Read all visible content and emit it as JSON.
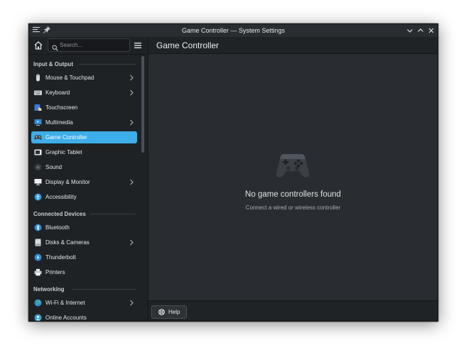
{
  "window": {
    "title": "Game Controller — System Settings"
  },
  "sidebar": {
    "search_placeholder": "Search...",
    "sections": [
      {
        "title": "Input & Output",
        "items": [
          {
            "label": "Mouse & Touchpad",
            "icon": "mouse-icon",
            "has_submenu": true
          },
          {
            "label": "Keyboard",
            "icon": "keyboard-icon",
            "has_submenu": true
          },
          {
            "label": "Touchscreen",
            "icon": "touchscreen-icon",
            "has_submenu": false
          },
          {
            "label": "Multimedia",
            "icon": "multimedia-icon",
            "has_submenu": true
          },
          {
            "label": "Game Controller",
            "icon": "gamepad-icon",
            "has_submenu": false,
            "active": true
          },
          {
            "label": "Graphic Tablet",
            "icon": "tablet-icon",
            "has_submenu": false
          },
          {
            "label": "Sound",
            "icon": "speaker-icon",
            "has_submenu": false
          },
          {
            "label": "Display & Monitor",
            "icon": "monitor-icon",
            "has_submenu": true
          },
          {
            "label": "Accessibility",
            "icon": "accessibility-icon",
            "has_submenu": false
          }
        ]
      },
      {
        "title": "Connected Devices",
        "items": [
          {
            "label": "Bluetooth",
            "icon": "bluetooth-icon",
            "has_submenu": false
          },
          {
            "label": "Disks & Cameras",
            "icon": "disk-icon",
            "has_submenu": true
          },
          {
            "label": "Thunderbolt",
            "icon": "thunderbolt-icon",
            "has_submenu": false
          },
          {
            "label": "Printers",
            "icon": "printer-icon",
            "has_submenu": false
          }
        ]
      },
      {
        "title": "Networking",
        "items": [
          {
            "label": "Wi-Fi & Internet",
            "icon": "globe-icon",
            "has_submenu": true
          },
          {
            "label": "Online Accounts",
            "icon": "online-accounts-icon",
            "has_submenu": false
          }
        ]
      }
    ]
  },
  "main": {
    "page_title": "Game Controller",
    "empty_state": {
      "icon": "gamepad-icon",
      "title": "No game controllers found",
      "subtitle": "Connect a wired or wireless controller"
    },
    "help_label": "Help"
  },
  "colors": {
    "accent": "#3daee9",
    "window_bg": "#202326",
    "content_bg": "#292c30"
  }
}
